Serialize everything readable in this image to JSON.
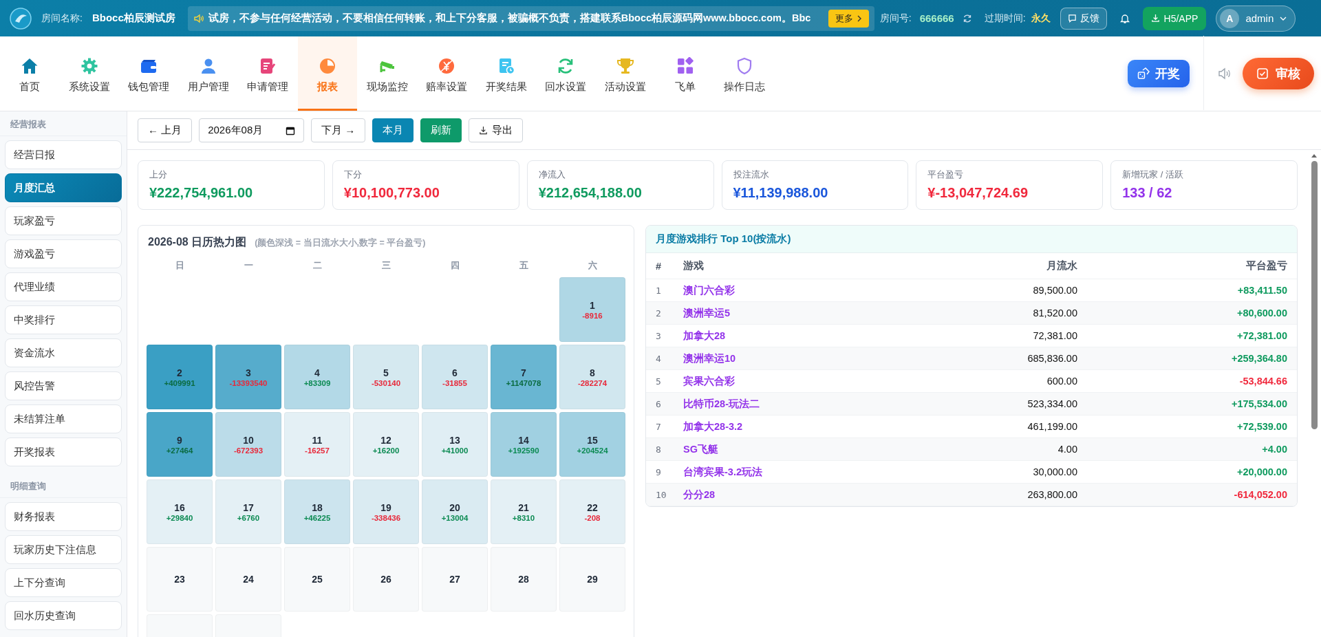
{
  "topbar": {
    "room_label": "房间名称:",
    "room_name": "Bbocc柏辰测试房",
    "notice": "试房，不参与任何经营活动，不要相信任何转账，和上下分客服，被骗概不负责，搭建联系Bbocc柏辰源码网www.bbocc.com。Bbc",
    "more_button": "更多",
    "room_no_label": "房间号:",
    "room_no": "666666",
    "expire_label": "过期时间:",
    "expire_value": "永久",
    "feedback_button": "反馈",
    "app_button": "H5/APP",
    "avatar": "A",
    "user": "admin"
  },
  "nav": [
    {
      "label": "首页",
      "selected": false
    },
    {
      "label": "系统设置",
      "selected": false
    },
    {
      "label": "钱包管理",
      "selected": false
    },
    {
      "label": "用户管理",
      "selected": false
    },
    {
      "label": "申请管理",
      "selected": false
    },
    {
      "label": "报表",
      "selected": true
    },
    {
      "label": "现场监控",
      "selected": false
    },
    {
      "label": "赔率设置",
      "selected": false
    },
    {
      "label": "开奖结果",
      "selected": false
    },
    {
      "label": "回水设置",
      "selected": false
    },
    {
      "label": "活动设置",
      "selected": false
    },
    {
      "label": "飞单",
      "selected": false
    },
    {
      "label": "操作日志",
      "selected": false
    }
  ],
  "actions": {
    "draw_button": "开奖",
    "review_button": "审核"
  },
  "sidebar": [
    {
      "title": "经营报表",
      "items": [
        {
          "label": "经营日报",
          "selected": false
        },
        {
          "label": "月度汇总",
          "selected": true
        },
        {
          "label": "玩家盈亏",
          "selected": false
        },
        {
          "label": "游戏盈亏",
          "selected": false
        },
        {
          "label": "代理业绩",
          "selected": false
        },
        {
          "label": "中奖排行",
          "selected": false
        },
        {
          "label": "资金流水",
          "selected": false
        },
        {
          "label": "风控告警",
          "selected": false
        },
        {
          "label": "未结算注单",
          "selected": false
        },
        {
          "label": "开奖报表",
          "selected": false
        }
      ]
    },
    {
      "title": "明细查询",
      "items": [
        {
          "label": "财务报表",
          "selected": false
        },
        {
          "label": "玩家历史下注信息",
          "selected": false
        },
        {
          "label": "上下分查询",
          "selected": false
        },
        {
          "label": "回水历史查询",
          "selected": false
        }
      ]
    }
  ],
  "toolbar": {
    "prev_button": "← 上月",
    "month_display": "2026年08月",
    "next_button": "下月 →",
    "current_button": "本月",
    "refresh_button": "刷新",
    "export_button": "导出"
  },
  "stats": [
    {
      "label": "上分",
      "value": "¥222,754,961.00",
      "color": "#0e9a5e"
    },
    {
      "label": "下分",
      "value": "¥10,100,773.00",
      "color": "#f0283c"
    },
    {
      "label": "净流入",
      "value": "¥212,654,188.00",
      "color": "#0e9a5e"
    },
    {
      "label": "投注流水",
      "value": "¥11,139,988.00",
      "color": "#1a56db"
    },
    {
      "label": "平台盈亏",
      "value": "¥-13,047,724.69",
      "color": "#f0283c"
    },
    {
      "label": "新增玩家 / 活跃",
      "value": "133 / 62",
      "color": "#9333ea"
    }
  ],
  "calendar": {
    "title": "2026-08 日历热力图",
    "subtitle": "(颜色深浅 = 当日流水大小,数字 = 平台盈亏)",
    "weekdays": [
      "日",
      "一",
      "二",
      "三",
      "四",
      "五",
      "六"
    ],
    "days": [
      {
        "kind": "blank"
      },
      {
        "kind": "blank"
      },
      {
        "kind": "blank"
      },
      {
        "kind": "blank"
      },
      {
        "kind": "blank"
      },
      {
        "kind": "blank"
      },
      {
        "kind": "day",
        "day": "1",
        "color": "#afd7e5",
        "value": {
          "text": "-8916",
          "color": "#e8293a"
        }
      },
      {
        "kind": "day",
        "day": "2",
        "color": "#3a9fc4",
        "value": {
          "text": "+409991",
          "color": "#0a6b40"
        }
      },
      {
        "kind": "day",
        "day": "3",
        "color": "#56accc",
        "value": {
          "text": "-13393540",
          "color": "#e8293a"
        }
      },
      {
        "kind": "day",
        "day": "4",
        "color": "#b3d9e7",
        "value": {
          "text": "+83309",
          "color": "#0b8a52"
        }
      },
      {
        "kind": "day",
        "day": "5",
        "color": "#d5e9f0",
        "value": {
          "text": "-530140",
          "color": "#e8293a"
        }
      },
      {
        "kind": "day",
        "day": "6",
        "color": "#cfe6ef",
        "value": {
          "text": "-31855",
          "color": "#e8293a"
        }
      },
      {
        "kind": "day",
        "day": "7",
        "color": "#69b6d2",
        "value": {
          "text": "+1147078",
          "color": "#0a6b40"
        }
      },
      {
        "kind": "day",
        "day": "8",
        "color": "#d1e7ef",
        "value": {
          "text": "-282274",
          "color": "#e8293a"
        }
      },
      {
        "kind": "day",
        "day": "9",
        "color": "#49a6c8",
        "value": {
          "text": "+27464",
          "color": "#0a6b40"
        }
      },
      {
        "kind": "day",
        "day": "10",
        "color": "#bbdce9",
        "value": {
          "text": "-672393",
          "color": "#e8293a"
        }
      },
      {
        "kind": "day",
        "day": "11",
        "color": "#e4f0f5",
        "value": {
          "text": "-16257",
          "color": "#e8293a"
        }
      },
      {
        "kind": "day",
        "day": "12",
        "color": "#e4f0f5",
        "value": {
          "text": "+16200",
          "color": "#0b8a52"
        }
      },
      {
        "kind": "day",
        "day": "13",
        "color": "#e0eef4",
        "value": {
          "text": "+41000",
          "color": "#0b8a52"
        }
      },
      {
        "kind": "day",
        "day": "14",
        "color": "#a0d0e1",
        "value": {
          "text": "+192590",
          "color": "#0b8a52"
        }
      },
      {
        "kind": "day",
        "day": "15",
        "color": "#a2d1e2",
        "value": {
          "text": "+204524",
          "color": "#0b8a52"
        }
      },
      {
        "kind": "day",
        "day": "16",
        "color": "#e4f0f5",
        "value": {
          "text": "+29840",
          "color": "#0b8a52"
        }
      },
      {
        "kind": "day",
        "day": "17",
        "color": "#e4f0f5",
        "value": {
          "text": "+6760",
          "color": "#0b8a52"
        }
      },
      {
        "kind": "day",
        "day": "18",
        "color": "#cce4ee",
        "value": {
          "text": "+46225",
          "color": "#0b8a52"
        }
      },
      {
        "kind": "day",
        "day": "19",
        "color": "#daebf2",
        "value": {
          "text": "-338436",
          "color": "#e8293a"
        }
      },
      {
        "kind": "day",
        "day": "20",
        "color": "#daebf2",
        "value": {
          "text": "+13004",
          "color": "#0b8a52"
        }
      },
      {
        "kind": "day",
        "day": "21",
        "color": "#e4f0f5",
        "value": {
          "text": "+8310",
          "color": "#0b8a52"
        }
      },
      {
        "kind": "day",
        "day": "22",
        "color": "#e4f0f5",
        "value": {
          "text": "-208",
          "color": "#e8293a"
        }
      },
      {
        "kind": "day",
        "day": "23"
      },
      {
        "kind": "day",
        "day": "24"
      },
      {
        "kind": "day",
        "day": "25"
      },
      {
        "kind": "day",
        "day": "26"
      },
      {
        "kind": "day",
        "day": "27"
      },
      {
        "kind": "day",
        "day": "28"
      },
      {
        "kind": "day",
        "day": "29"
      },
      {
        "kind": "cut"
      },
      {
        "kind": "cut"
      }
    ]
  },
  "ranking": {
    "title": "月度游戏排行 Top 10(按流水)",
    "columns": [
      "#",
      "游戏",
      "月流水",
      "平台盈亏"
    ],
    "rows": [
      {
        "rank": "1",
        "game": "澳门六合彩",
        "turnover": "89,500.00",
        "profit": "+83,411.50",
        "color": "#0e9a5e"
      },
      {
        "rank": "2",
        "game": "澳洲幸运5",
        "turnover": "81,520.00",
        "profit": "+80,600.00",
        "color": "#0e9a5e"
      },
      {
        "rank": "3",
        "game": "加拿大28",
        "turnover": "72,381.00",
        "profit": "+72,381.00",
        "color": "#0e9a5e"
      },
      {
        "rank": "4",
        "game": "澳洲幸运10",
        "turnover": "685,836.00",
        "profit": "+259,364.80",
        "color": "#0e9a5e"
      },
      {
        "rank": "5",
        "game": "宾果六合彩",
        "turnover": "600.00",
        "profit": "-53,844.66",
        "color": "#f0283c"
      },
      {
        "rank": "6",
        "game": "比特币28-玩法二",
        "turnover": "523,334.00",
        "profit": "+175,534.00",
        "color": "#0e9a5e"
      },
      {
        "rank": "7",
        "game": "加拿大28-3.2",
        "turnover": "461,199.00",
        "profit": "+72,539.00",
        "color": "#0e9a5e"
      },
      {
        "rank": "8",
        "game": "SG飞艇",
        "turnover": "4.00",
        "profit": "+4.00",
        "color": "#0e9a5e"
      },
      {
        "rank": "9",
        "game": "台湾宾果-3.2玩法",
        "turnover": "30,000.00",
        "profit": "+20,000.00",
        "color": "#0e9a5e"
      },
      {
        "rank": "10",
        "game": "分分28",
        "turnover": "263,800.00",
        "profit": "-614,052.00",
        "color": "#f0283c"
      }
    ]
  }
}
